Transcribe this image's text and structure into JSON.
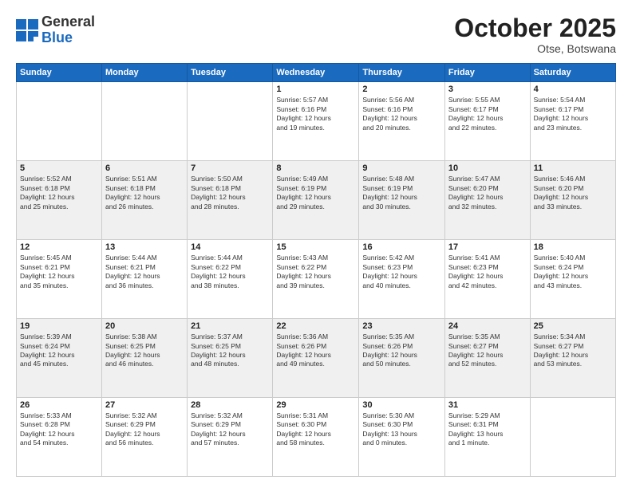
{
  "logo": {
    "line1": "General",
    "line2": "Blue"
  },
  "title": "October 2025",
  "location": "Otse, Botswana",
  "weekdays": [
    "Sunday",
    "Monday",
    "Tuesday",
    "Wednesday",
    "Thursday",
    "Friday",
    "Saturday"
  ],
  "weeks": [
    [
      {
        "day": "",
        "info": ""
      },
      {
        "day": "",
        "info": ""
      },
      {
        "day": "",
        "info": ""
      },
      {
        "day": "1",
        "info": "Sunrise: 5:57 AM\nSunset: 6:16 PM\nDaylight: 12 hours\nand 19 minutes."
      },
      {
        "day": "2",
        "info": "Sunrise: 5:56 AM\nSunset: 6:16 PM\nDaylight: 12 hours\nand 20 minutes."
      },
      {
        "day": "3",
        "info": "Sunrise: 5:55 AM\nSunset: 6:17 PM\nDaylight: 12 hours\nand 22 minutes."
      },
      {
        "day": "4",
        "info": "Sunrise: 5:54 AM\nSunset: 6:17 PM\nDaylight: 12 hours\nand 23 minutes."
      }
    ],
    [
      {
        "day": "5",
        "info": "Sunrise: 5:52 AM\nSunset: 6:18 PM\nDaylight: 12 hours\nand 25 minutes."
      },
      {
        "day": "6",
        "info": "Sunrise: 5:51 AM\nSunset: 6:18 PM\nDaylight: 12 hours\nand 26 minutes."
      },
      {
        "day": "7",
        "info": "Sunrise: 5:50 AM\nSunset: 6:18 PM\nDaylight: 12 hours\nand 28 minutes."
      },
      {
        "day": "8",
        "info": "Sunrise: 5:49 AM\nSunset: 6:19 PM\nDaylight: 12 hours\nand 29 minutes."
      },
      {
        "day": "9",
        "info": "Sunrise: 5:48 AM\nSunset: 6:19 PM\nDaylight: 12 hours\nand 30 minutes."
      },
      {
        "day": "10",
        "info": "Sunrise: 5:47 AM\nSunset: 6:20 PM\nDaylight: 12 hours\nand 32 minutes."
      },
      {
        "day": "11",
        "info": "Sunrise: 5:46 AM\nSunset: 6:20 PM\nDaylight: 12 hours\nand 33 minutes."
      }
    ],
    [
      {
        "day": "12",
        "info": "Sunrise: 5:45 AM\nSunset: 6:21 PM\nDaylight: 12 hours\nand 35 minutes."
      },
      {
        "day": "13",
        "info": "Sunrise: 5:44 AM\nSunset: 6:21 PM\nDaylight: 12 hours\nand 36 minutes."
      },
      {
        "day": "14",
        "info": "Sunrise: 5:44 AM\nSunset: 6:22 PM\nDaylight: 12 hours\nand 38 minutes."
      },
      {
        "day": "15",
        "info": "Sunrise: 5:43 AM\nSunset: 6:22 PM\nDaylight: 12 hours\nand 39 minutes."
      },
      {
        "day": "16",
        "info": "Sunrise: 5:42 AM\nSunset: 6:23 PM\nDaylight: 12 hours\nand 40 minutes."
      },
      {
        "day": "17",
        "info": "Sunrise: 5:41 AM\nSunset: 6:23 PM\nDaylight: 12 hours\nand 42 minutes."
      },
      {
        "day": "18",
        "info": "Sunrise: 5:40 AM\nSunset: 6:24 PM\nDaylight: 12 hours\nand 43 minutes."
      }
    ],
    [
      {
        "day": "19",
        "info": "Sunrise: 5:39 AM\nSunset: 6:24 PM\nDaylight: 12 hours\nand 45 minutes."
      },
      {
        "day": "20",
        "info": "Sunrise: 5:38 AM\nSunset: 6:25 PM\nDaylight: 12 hours\nand 46 minutes."
      },
      {
        "day": "21",
        "info": "Sunrise: 5:37 AM\nSunset: 6:25 PM\nDaylight: 12 hours\nand 48 minutes."
      },
      {
        "day": "22",
        "info": "Sunrise: 5:36 AM\nSunset: 6:26 PM\nDaylight: 12 hours\nand 49 minutes."
      },
      {
        "day": "23",
        "info": "Sunrise: 5:35 AM\nSunset: 6:26 PM\nDaylight: 12 hours\nand 50 minutes."
      },
      {
        "day": "24",
        "info": "Sunrise: 5:35 AM\nSunset: 6:27 PM\nDaylight: 12 hours\nand 52 minutes."
      },
      {
        "day": "25",
        "info": "Sunrise: 5:34 AM\nSunset: 6:27 PM\nDaylight: 12 hours\nand 53 minutes."
      }
    ],
    [
      {
        "day": "26",
        "info": "Sunrise: 5:33 AM\nSunset: 6:28 PM\nDaylight: 12 hours\nand 54 minutes."
      },
      {
        "day": "27",
        "info": "Sunrise: 5:32 AM\nSunset: 6:29 PM\nDaylight: 12 hours\nand 56 minutes."
      },
      {
        "day": "28",
        "info": "Sunrise: 5:32 AM\nSunset: 6:29 PM\nDaylight: 12 hours\nand 57 minutes."
      },
      {
        "day": "29",
        "info": "Sunrise: 5:31 AM\nSunset: 6:30 PM\nDaylight: 12 hours\nand 58 minutes."
      },
      {
        "day": "30",
        "info": "Sunrise: 5:30 AM\nSunset: 6:30 PM\nDaylight: 13 hours\nand 0 minutes."
      },
      {
        "day": "31",
        "info": "Sunrise: 5:29 AM\nSunset: 6:31 PM\nDaylight: 13 hours\nand 1 minute."
      },
      {
        "day": "",
        "info": ""
      }
    ]
  ]
}
